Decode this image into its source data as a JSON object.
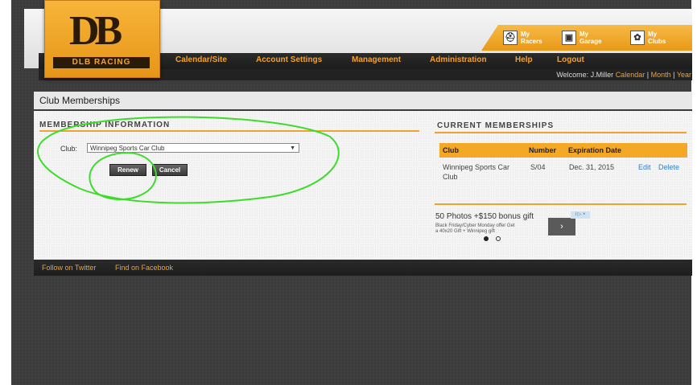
{
  "logo": {
    "mark": "DB",
    "text": "DLB RACING"
  },
  "nav": {
    "items": [
      "Calendar/Site",
      "Account Settings",
      "Management",
      "Administration",
      "Help",
      "Logout"
    ]
  },
  "quick_links": [
    {
      "label_top": "My",
      "label_bottom": "Racers",
      "icon": "helmet-icon"
    },
    {
      "label_top": "My",
      "label_bottom": "Garage",
      "icon": "garage-icon"
    },
    {
      "label_top": "My",
      "label_bottom": "Clubs",
      "icon": "clubs-icon"
    }
  ],
  "user_bar": {
    "welcome": "Welcome: J.Miller",
    "links": [
      "Calendar",
      "Month",
      "Year"
    ],
    "sep": "|"
  },
  "page_title": "Club Memberships",
  "membership_info": {
    "heading": "MEMBERSHIP INFORMATION",
    "club_label": "Club:",
    "club_selected": "Winnipeg Sports Car Club",
    "renew_label": "Renew",
    "cancel_label": "Cancel"
  },
  "current_memberships": {
    "heading": "CURRENT MEMBERSHIPS",
    "columns": [
      "Club",
      "Number",
      "Expiration Date"
    ],
    "rows": [
      {
        "club": "Winnipeg Sports Car",
        "club_sub": "Club",
        "number": "S/04",
        "expiration": "Dec. 31, 2015",
        "edit": "Edit",
        "delete": "Delete"
      }
    ]
  },
  "ad": {
    "title": "50 Photos +$150 bonus gift",
    "line1": "Black Friday/Cyber Monday offer Get",
    "line2": "a 40x20 Gift + Winnipeg gift",
    "arrow": "›",
    "choice": "i ▷ ×"
  },
  "footer": {
    "links": [
      "Follow on Twitter",
      "Find on Facebook"
    ]
  },
  "colors": {
    "accent": "#f0a231",
    "annotation": "#3ddc2a",
    "background": "#3c3c3c"
  }
}
